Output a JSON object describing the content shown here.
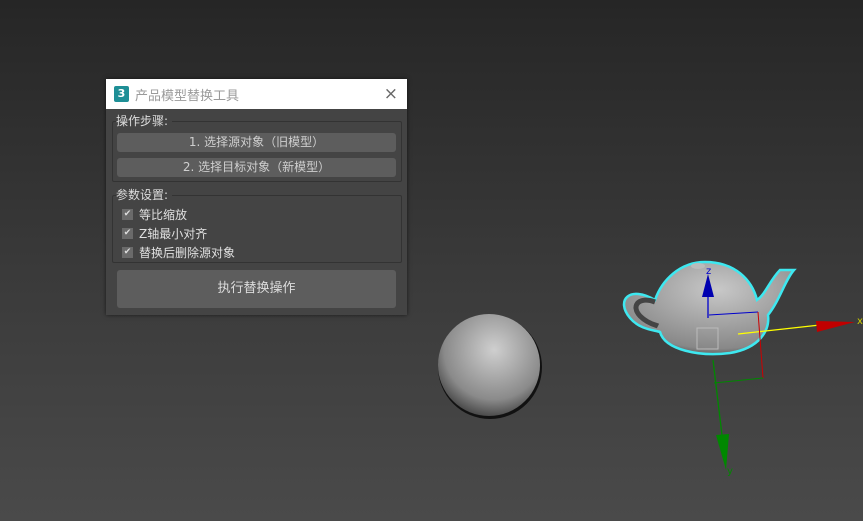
{
  "dialog": {
    "title": "产品模型替换工具",
    "logo": "3",
    "close": "×",
    "steps_label": "操作步骤:",
    "step1": "1. 选择源对象（旧模型）",
    "step2": "2. 选择目标对象（新模型）",
    "params_label": "参数设置:",
    "options": [
      {
        "label": "等比缩放",
        "checked": true
      },
      {
        "label": "Z轴最小对齐",
        "checked": true
      },
      {
        "label": "替换后删除源对象",
        "checked": true
      }
    ],
    "execute": "执行替换操作"
  },
  "gizmo": {
    "x": "x",
    "y": "y",
    "z": "z"
  },
  "colors": {
    "selection": "#3ee8f0",
    "x_axis": "#c00000",
    "y_axis": "#008800",
    "z_axis": "#0000b0"
  }
}
